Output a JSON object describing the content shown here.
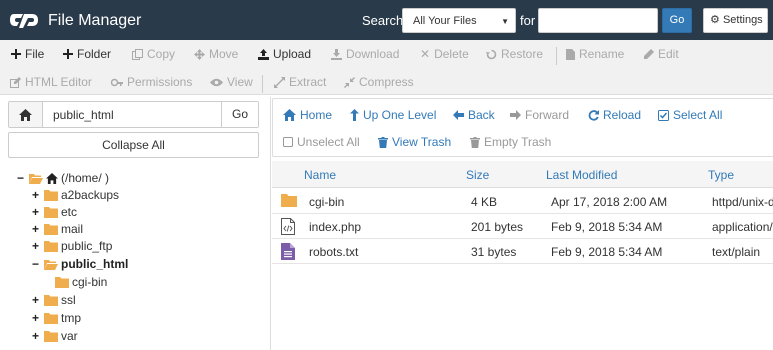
{
  "header": {
    "title": "File Manager",
    "search_label": "Search",
    "search_scope": "All Your Files",
    "for_label": "for",
    "search_value": "",
    "go_label": "Go",
    "settings_label": "Settings"
  },
  "toolbar": {
    "row1": [
      {
        "label": "File",
        "icon": "plus-icon",
        "enabled": true
      },
      {
        "label": "Folder",
        "icon": "plus-icon",
        "enabled": true
      },
      {
        "label": "Copy",
        "icon": "copy-icon",
        "enabled": false
      },
      {
        "label": "Move",
        "icon": "move-icon",
        "enabled": false
      },
      {
        "label": "Upload",
        "icon": "upload-icon",
        "enabled": true
      },
      {
        "label": "Download",
        "icon": "download-icon",
        "enabled": false
      },
      {
        "label": "Delete",
        "icon": "close-icon",
        "enabled": false
      },
      {
        "label": "Restore",
        "icon": "restore-icon",
        "enabled": false
      },
      {
        "label": "Rename",
        "icon": "file-icon",
        "enabled": false
      },
      {
        "label": "Edit",
        "icon": "pencil-icon",
        "enabled": false
      }
    ],
    "row2": [
      {
        "label": "HTML Editor",
        "icon": "edit-icon",
        "enabled": false
      },
      {
        "label": "Permissions",
        "icon": "key-icon",
        "enabled": false
      },
      {
        "label": "View",
        "icon": "eye-icon",
        "enabled": false
      },
      {
        "label": "Extract",
        "icon": "expand-icon",
        "enabled": false
      },
      {
        "label": "Compress",
        "icon": "compress-icon",
        "enabled": false
      }
    ]
  },
  "left_panel": {
    "path_value": "public_html",
    "go_label": "Go",
    "collapse_label": "Collapse All",
    "tree": [
      {
        "label": "(/home/          )",
        "level": 0,
        "toggle": "−",
        "icon": "home-folder",
        "bold": false
      },
      {
        "label": "a2backups",
        "level": 1,
        "toggle": "+",
        "bold": false
      },
      {
        "label": "etc",
        "level": 1,
        "toggle": "+",
        "bold": false
      },
      {
        "label": "mail",
        "level": 1,
        "toggle": "+",
        "bold": false
      },
      {
        "label": "public_ftp",
        "level": 1,
        "toggle": "+",
        "bold": false
      },
      {
        "label": "public_html",
        "level": 1,
        "toggle": "−",
        "bold": true
      },
      {
        "label": "cgi-bin",
        "level": 2,
        "toggle": "",
        "bold": false
      },
      {
        "label": "ssl",
        "level": 1,
        "toggle": "+",
        "bold": false
      },
      {
        "label": "tmp",
        "level": 1,
        "toggle": "+",
        "bold": false
      },
      {
        "label": "var",
        "level": 1,
        "toggle": "+",
        "bold": false
      }
    ]
  },
  "nav": {
    "home": "Home",
    "up": "Up One Level",
    "back": "Back",
    "forward": "Forward",
    "reload": "Reload",
    "select_all": "Select All",
    "unselect_all": "Unselect All",
    "view_trash": "View Trash",
    "empty_trash": "Empty Trash"
  },
  "table": {
    "columns": [
      "Name",
      "Size",
      "Last Modified",
      "Type"
    ],
    "rows": [
      {
        "name": "cgi-bin",
        "size": "4 KB",
        "modified": "Apr 17, 2018 2:00 AM",
        "type": "httpd/unix-directory",
        "icon": "folder-icon"
      },
      {
        "name": "index.php",
        "size": "201 bytes",
        "modified": "Feb 9, 2018 5:34 AM",
        "type": "application/x-httpd-php",
        "icon": "code-file-icon"
      },
      {
        "name": "robots.txt",
        "size": "31 bytes",
        "modified": "Feb 9, 2018 5:34 AM",
        "type": "text/plain",
        "icon": "text-file-icon"
      }
    ]
  },
  "colors": {
    "header_bg": "#293a4a",
    "accent": "#337ab7",
    "folder": "#f0ad4e",
    "text_file": "#7b5ea7"
  }
}
